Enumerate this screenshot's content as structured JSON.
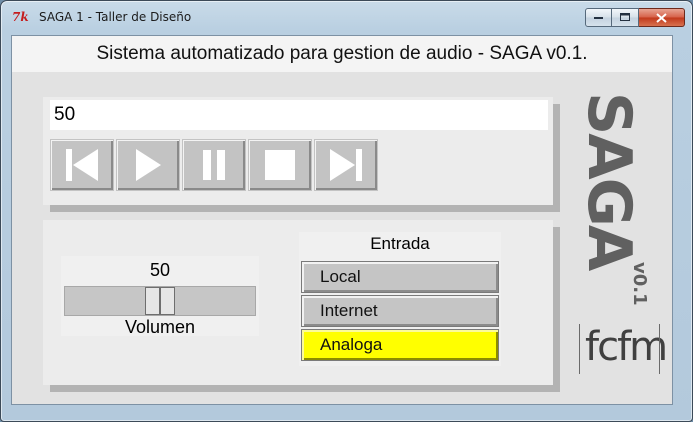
{
  "window": {
    "title": "SAGA 1 - Taller de Diseño",
    "icon": "tk-feather-icon",
    "controls": [
      "minimize",
      "maximize",
      "close"
    ]
  },
  "header": {
    "title": "Sistema automatizado para gestion de audio - SAGA v0.1."
  },
  "player": {
    "track_value": "50",
    "buttons": [
      {
        "name": "previous",
        "icon": "skip-back-icon"
      },
      {
        "name": "play",
        "icon": "play-icon"
      },
      {
        "name": "pause",
        "icon": "pause-icon"
      },
      {
        "name": "stop",
        "icon": "stop-icon"
      },
      {
        "name": "next",
        "icon": "skip-forward-icon"
      }
    ]
  },
  "volume": {
    "value": "50",
    "label": "Volumen",
    "min": 0,
    "max": 100,
    "level_fraction": 0.5
  },
  "input": {
    "title": "Entrada",
    "options": [
      {
        "label": "Local",
        "selected": false
      },
      {
        "label": "Internet",
        "selected": false
      },
      {
        "label": "Analoga",
        "selected": true
      }
    ],
    "selected_color": "#ffff00"
  },
  "logo": {
    "name": "SAGA",
    "version": "v0.1",
    "institution": "fcfm"
  }
}
